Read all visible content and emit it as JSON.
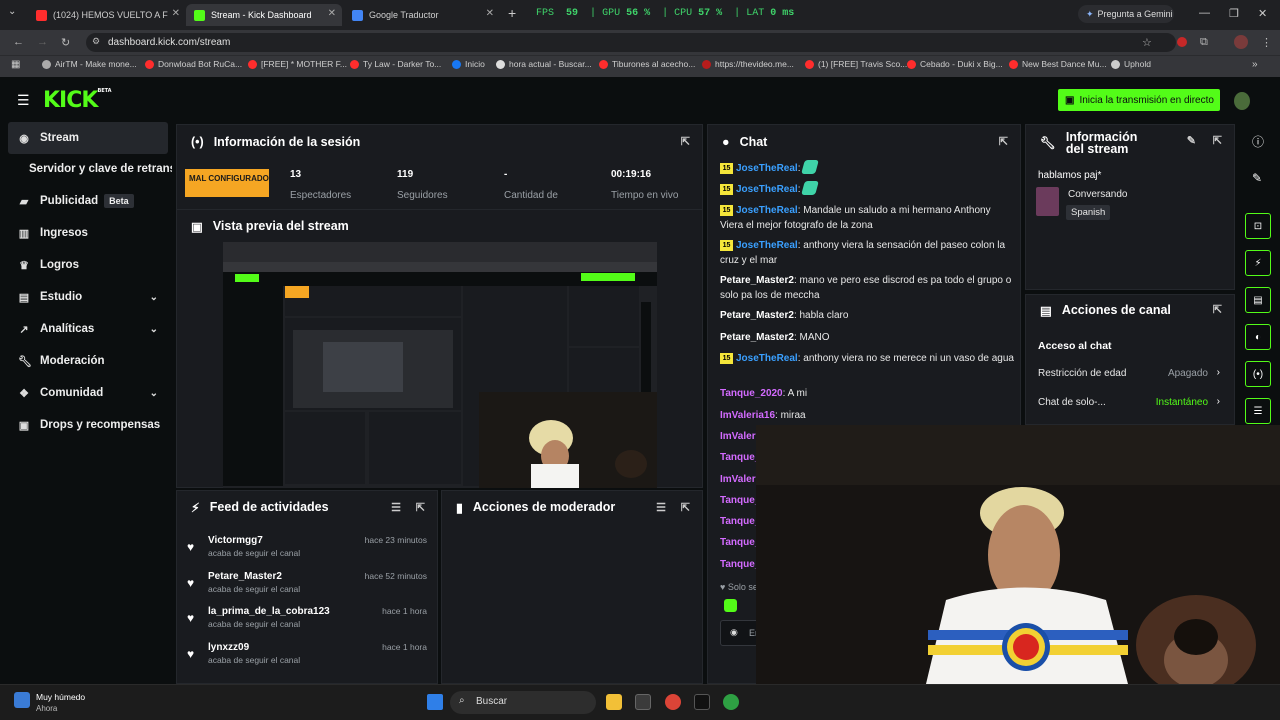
{
  "browser": {
    "tabs": [
      {
        "label": "(1024) HEMOS VUELTO A F",
        "color": "#ff2d2d"
      },
      {
        "label": "Stream - Kick Dashboard",
        "color": "#53fc18"
      },
      {
        "label": "Google Traductor",
        "color": "#4285f4"
      }
    ],
    "perf": {
      "fps_label": "FPS",
      "fps": "59",
      "gpu_label": "GPU",
      "gpu": "56 %",
      "cpu_label": "CPU",
      "cpu": "57 %",
      "lat_label": "LAT",
      "lat": "0 ms"
    },
    "gemini": "Pregunta a Gemini",
    "url": "dashboard.kick.com/stream",
    "bookmarks": [
      "AirTM - Make mone...",
      "Donwload Bot RuCa...",
      "[FREE] * MOTHER F...",
      "Ty Law - Darker To...",
      "Inicio",
      "hora actual - Buscar...",
      "Tiburones al acecho...",
      "https://thevideo.me...",
      "(1) [FREE] Travis Sco...",
      "Cebado - Duki x Big...",
      "New Best Dance Mu...",
      "Uphold"
    ]
  },
  "header": {
    "logo": "KICK",
    "logo_badge": "BETA",
    "go_live": "Inicia la transmisión en directo"
  },
  "sidebar": {
    "items": [
      {
        "label": "Stream",
        "icon": "broadcast-icon"
      },
      {
        "label": "Servidor y clave de retransmisión",
        "icon": ""
      },
      {
        "label": "Publicidad",
        "icon": "megaphone-icon",
        "badge": "Beta"
      },
      {
        "label": "Ingresos",
        "icon": "bank-icon"
      },
      {
        "label": "Logros",
        "icon": "trophy-icon"
      },
      {
        "label": "Estudio",
        "icon": "studio-icon"
      },
      {
        "label": "Analíticas",
        "icon": "analytics-icon"
      },
      {
        "label": "Moderación",
        "icon": "wrench-icon"
      },
      {
        "label": "Comunidad",
        "icon": "community-icon"
      },
      {
        "label": "Drops y recompensas",
        "icon": "gift-icon"
      }
    ]
  },
  "session": {
    "title": "Información de la sesión",
    "status": "MAL CONFIGURADO",
    "stats": [
      {
        "value": "13",
        "label": "Espectadores"
      },
      {
        "value": "119",
        "label": "Seguidores"
      },
      {
        "value": "-",
        "label": "Cantidad de"
      },
      {
        "value": "00:19:16",
        "label": "Tiempo en vivo"
      }
    ]
  },
  "preview": {
    "title": "Vista previa del stream"
  },
  "feed": {
    "title": "Feed de actividades",
    "items": [
      {
        "name": "Victormgg7",
        "action": "acaba de seguir el canal",
        "time": "hace 23 minutos"
      },
      {
        "name": "Petare_Master2",
        "action": "acaba de seguir el canal",
        "time": "hace 52 minutos"
      },
      {
        "name": "la_prima_de_la_cobra123",
        "action": "acaba de seguir el canal",
        "time": "hace 1 hora"
      },
      {
        "name": "lynxzz09",
        "action": "acaba de seguir el canal",
        "time": "hace 1 hora"
      }
    ]
  },
  "modactions": {
    "title": "Acciones de moderador"
  },
  "chat": {
    "title": "Chat",
    "messages": [
      {
        "user": "JoseTheReal",
        "badge": "15",
        "color": "#3aa0ff",
        "text": ":"
      },
      {
        "user": "JoseTheReal",
        "badge": "15",
        "color": "#3aa0ff",
        "text": ":"
      },
      {
        "user": "JoseTheReal",
        "badge": "15",
        "color": "#3aa0ff",
        "text": ": Mandale un saludo a mi hermano Anthony Viera el mejor fotografo de la zona"
      },
      {
        "user": "JoseTheReal",
        "badge": "15",
        "color": "#3aa0ff",
        "text": ": anthony viera la sensación del paseo colon la cruz y el mar"
      },
      {
        "user": "Petare_Master2",
        "badge": "",
        "color": "#ffffff",
        "text": ": mano ve pero ese discrod es pa todo el grupo o solo pa los de meccha"
      },
      {
        "user": "Petare_Master2",
        "badge": "",
        "color": "#ffffff",
        "text": ": habla claro"
      },
      {
        "user": "Petare_Master2",
        "badge": "",
        "color": "#ffffff",
        "text": ": MANO"
      },
      {
        "user": "JoseTheReal",
        "badge": "15",
        "color": "#3aa0ff",
        "text": ": anthony viera no se merece ni un vaso de agua"
      },
      {
        "user": "Tanque_2020",
        "badge": "",
        "color": "#d36bff",
        "text": ": A mi"
      },
      {
        "user": "ImValeria16",
        "badge": "",
        "color": "#d36bff",
        "text": ": miraa"
      },
      {
        "user": "ImValeri",
        "badge": "",
        "color": "#d36bff",
        "text": ""
      },
      {
        "user": "Tanque_",
        "badge": "",
        "color": "#d36bff",
        "text": ""
      },
      {
        "user": "ImValeri",
        "badge": "",
        "color": "#d36bff",
        "text": ""
      },
      {
        "user": "Tanque_",
        "badge": "",
        "color": "#d36bff",
        "text": ""
      },
      {
        "user": "Tanque_",
        "badge": "",
        "color": "#d36bff",
        "text": ""
      },
      {
        "user": "Tanque_",
        "badge": "",
        "color": "#d36bff",
        "text": ""
      },
      {
        "user": "Tanque_",
        "badge": "",
        "color": "#d36bff",
        "text": ""
      }
    ],
    "footer_note": "Solo se",
    "input_placeholder": "Er"
  },
  "stream_info": {
    "title": "Información del stream",
    "stream_title": "hablamos paj*",
    "category": "Conversando",
    "language": "Spanish"
  },
  "channel_actions": {
    "title": "Acciones de canal",
    "section": "Acceso al chat",
    "rows": [
      {
        "label": "Restricción de edad",
        "value": "Apagado",
        "color": "#9aa0a6"
      },
      {
        "label": "Chat de solo-...",
        "value": "Instantáneo",
        "color": "#53fc18"
      }
    ]
  },
  "taskbar": {
    "weather": "Muy húmedo",
    "weather_sub": "Ahora",
    "search": "Buscar"
  },
  "colors": {
    "accent": "#53fc18",
    "warning": "#f5a623",
    "panel": "#191b1f",
    "bg": "#0b0e0f"
  }
}
